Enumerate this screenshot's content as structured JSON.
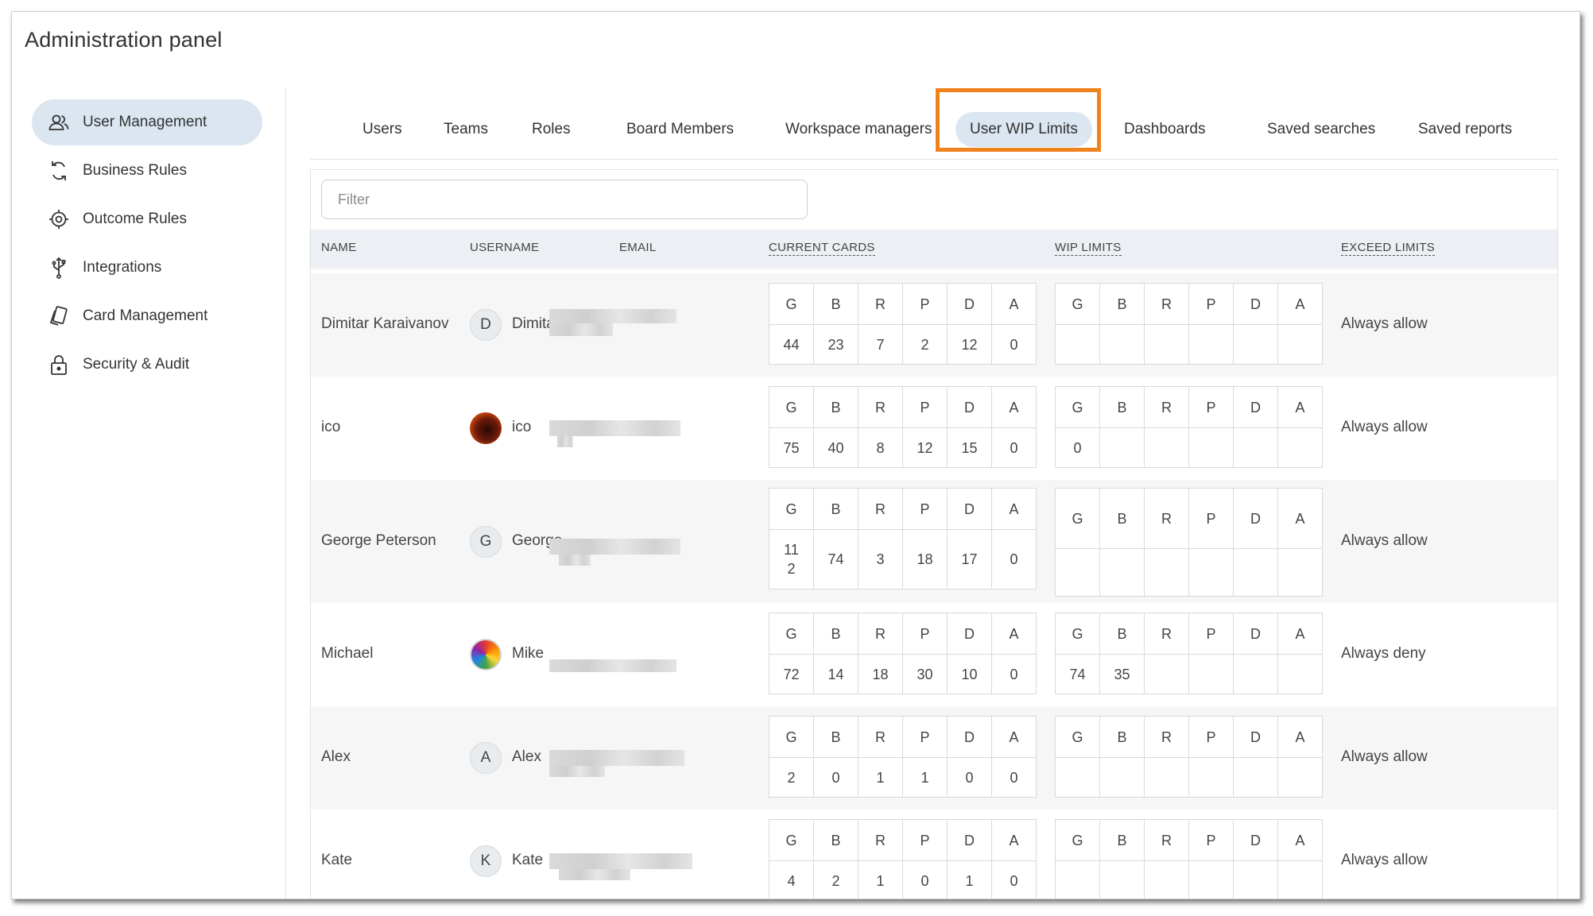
{
  "app": {
    "title": "Administration panel"
  },
  "sidebar": {
    "items": [
      {
        "label": "User Management",
        "icon": "users-icon",
        "active": true
      },
      {
        "label": "Business Rules",
        "icon": "refresh-icon"
      },
      {
        "label": "Outcome Rules",
        "icon": "target-icon"
      },
      {
        "label": "Integrations",
        "icon": "usb-icon"
      },
      {
        "label": "Card Management",
        "icon": "cards-icon"
      },
      {
        "label": "Security & Audit",
        "icon": "lock-icon"
      }
    ]
  },
  "tabs": [
    {
      "label": "Users"
    },
    {
      "label": "Teams"
    },
    {
      "label": "Roles"
    },
    {
      "label": "Board Members"
    },
    {
      "label": "Workspace managers"
    },
    {
      "label": "User WIP Limits",
      "active": true
    },
    {
      "label": "Dashboards"
    },
    {
      "label": "Saved searches"
    },
    {
      "label": "Saved reports"
    }
  ],
  "filter": {
    "placeholder": "Filter",
    "value": ""
  },
  "table": {
    "headers": {
      "name": "NAME",
      "username": "USERNAME",
      "email": "EMAIL",
      "current_cards": "CURRENT CARDS",
      "wip_limits": "WIP LIMITS",
      "exceed_limits": "EXCEED LIMITS"
    },
    "lane_letters": [
      "G",
      "B",
      "R",
      "P",
      "D",
      "A"
    ],
    "rows": [
      {
        "name": "Dimitar Karaivanov",
        "avatar_letter": "D",
        "username": "Dimitar",
        "current": [
          "44",
          "23",
          "7",
          "2",
          "12",
          "0"
        ],
        "wip": [
          "",
          "",
          "",
          "",
          "",
          ""
        ],
        "exceed": "Always allow"
      },
      {
        "name": "ico",
        "avatar_letter": "",
        "username": "ico",
        "current": [
          "75",
          "40",
          "8",
          "12",
          "15",
          "0"
        ],
        "wip": [
          "0",
          "",
          "",
          "",
          "",
          ""
        ],
        "exceed": "Always allow"
      },
      {
        "name": "George Peterson",
        "avatar_letter": "G",
        "username": "George",
        "current": [
          "11\n2",
          "74",
          "3",
          "18",
          "17",
          "0"
        ],
        "wip": [
          "",
          "",
          "",
          "",
          "",
          ""
        ],
        "exceed": "Always allow"
      },
      {
        "name": "Michael",
        "avatar_letter": "",
        "username": "Mike",
        "current": [
          "72",
          "14",
          "18",
          "30",
          "10",
          "0"
        ],
        "wip": [
          "74",
          "35",
          "",
          "",
          "",
          ""
        ],
        "exceed": "Always deny"
      },
      {
        "name": "Alex",
        "avatar_letter": "A",
        "username": "Alex",
        "current": [
          "2",
          "0",
          "1",
          "1",
          "0",
          "0"
        ],
        "wip": [
          "",
          "",
          "",
          "",
          "",
          ""
        ],
        "exceed": "Always allow"
      },
      {
        "name": "Kate",
        "avatar_letter": "K",
        "username": "Kate",
        "current": [
          "4",
          "2",
          "1",
          "0",
          "1",
          "0"
        ],
        "wip": [
          "",
          "",
          "",
          "",
          "",
          ""
        ],
        "exceed": "Always allow"
      }
    ]
  },
  "colors": {
    "accent_highlight": "#f0821e",
    "active_bg": "#dbe6f1"
  }
}
